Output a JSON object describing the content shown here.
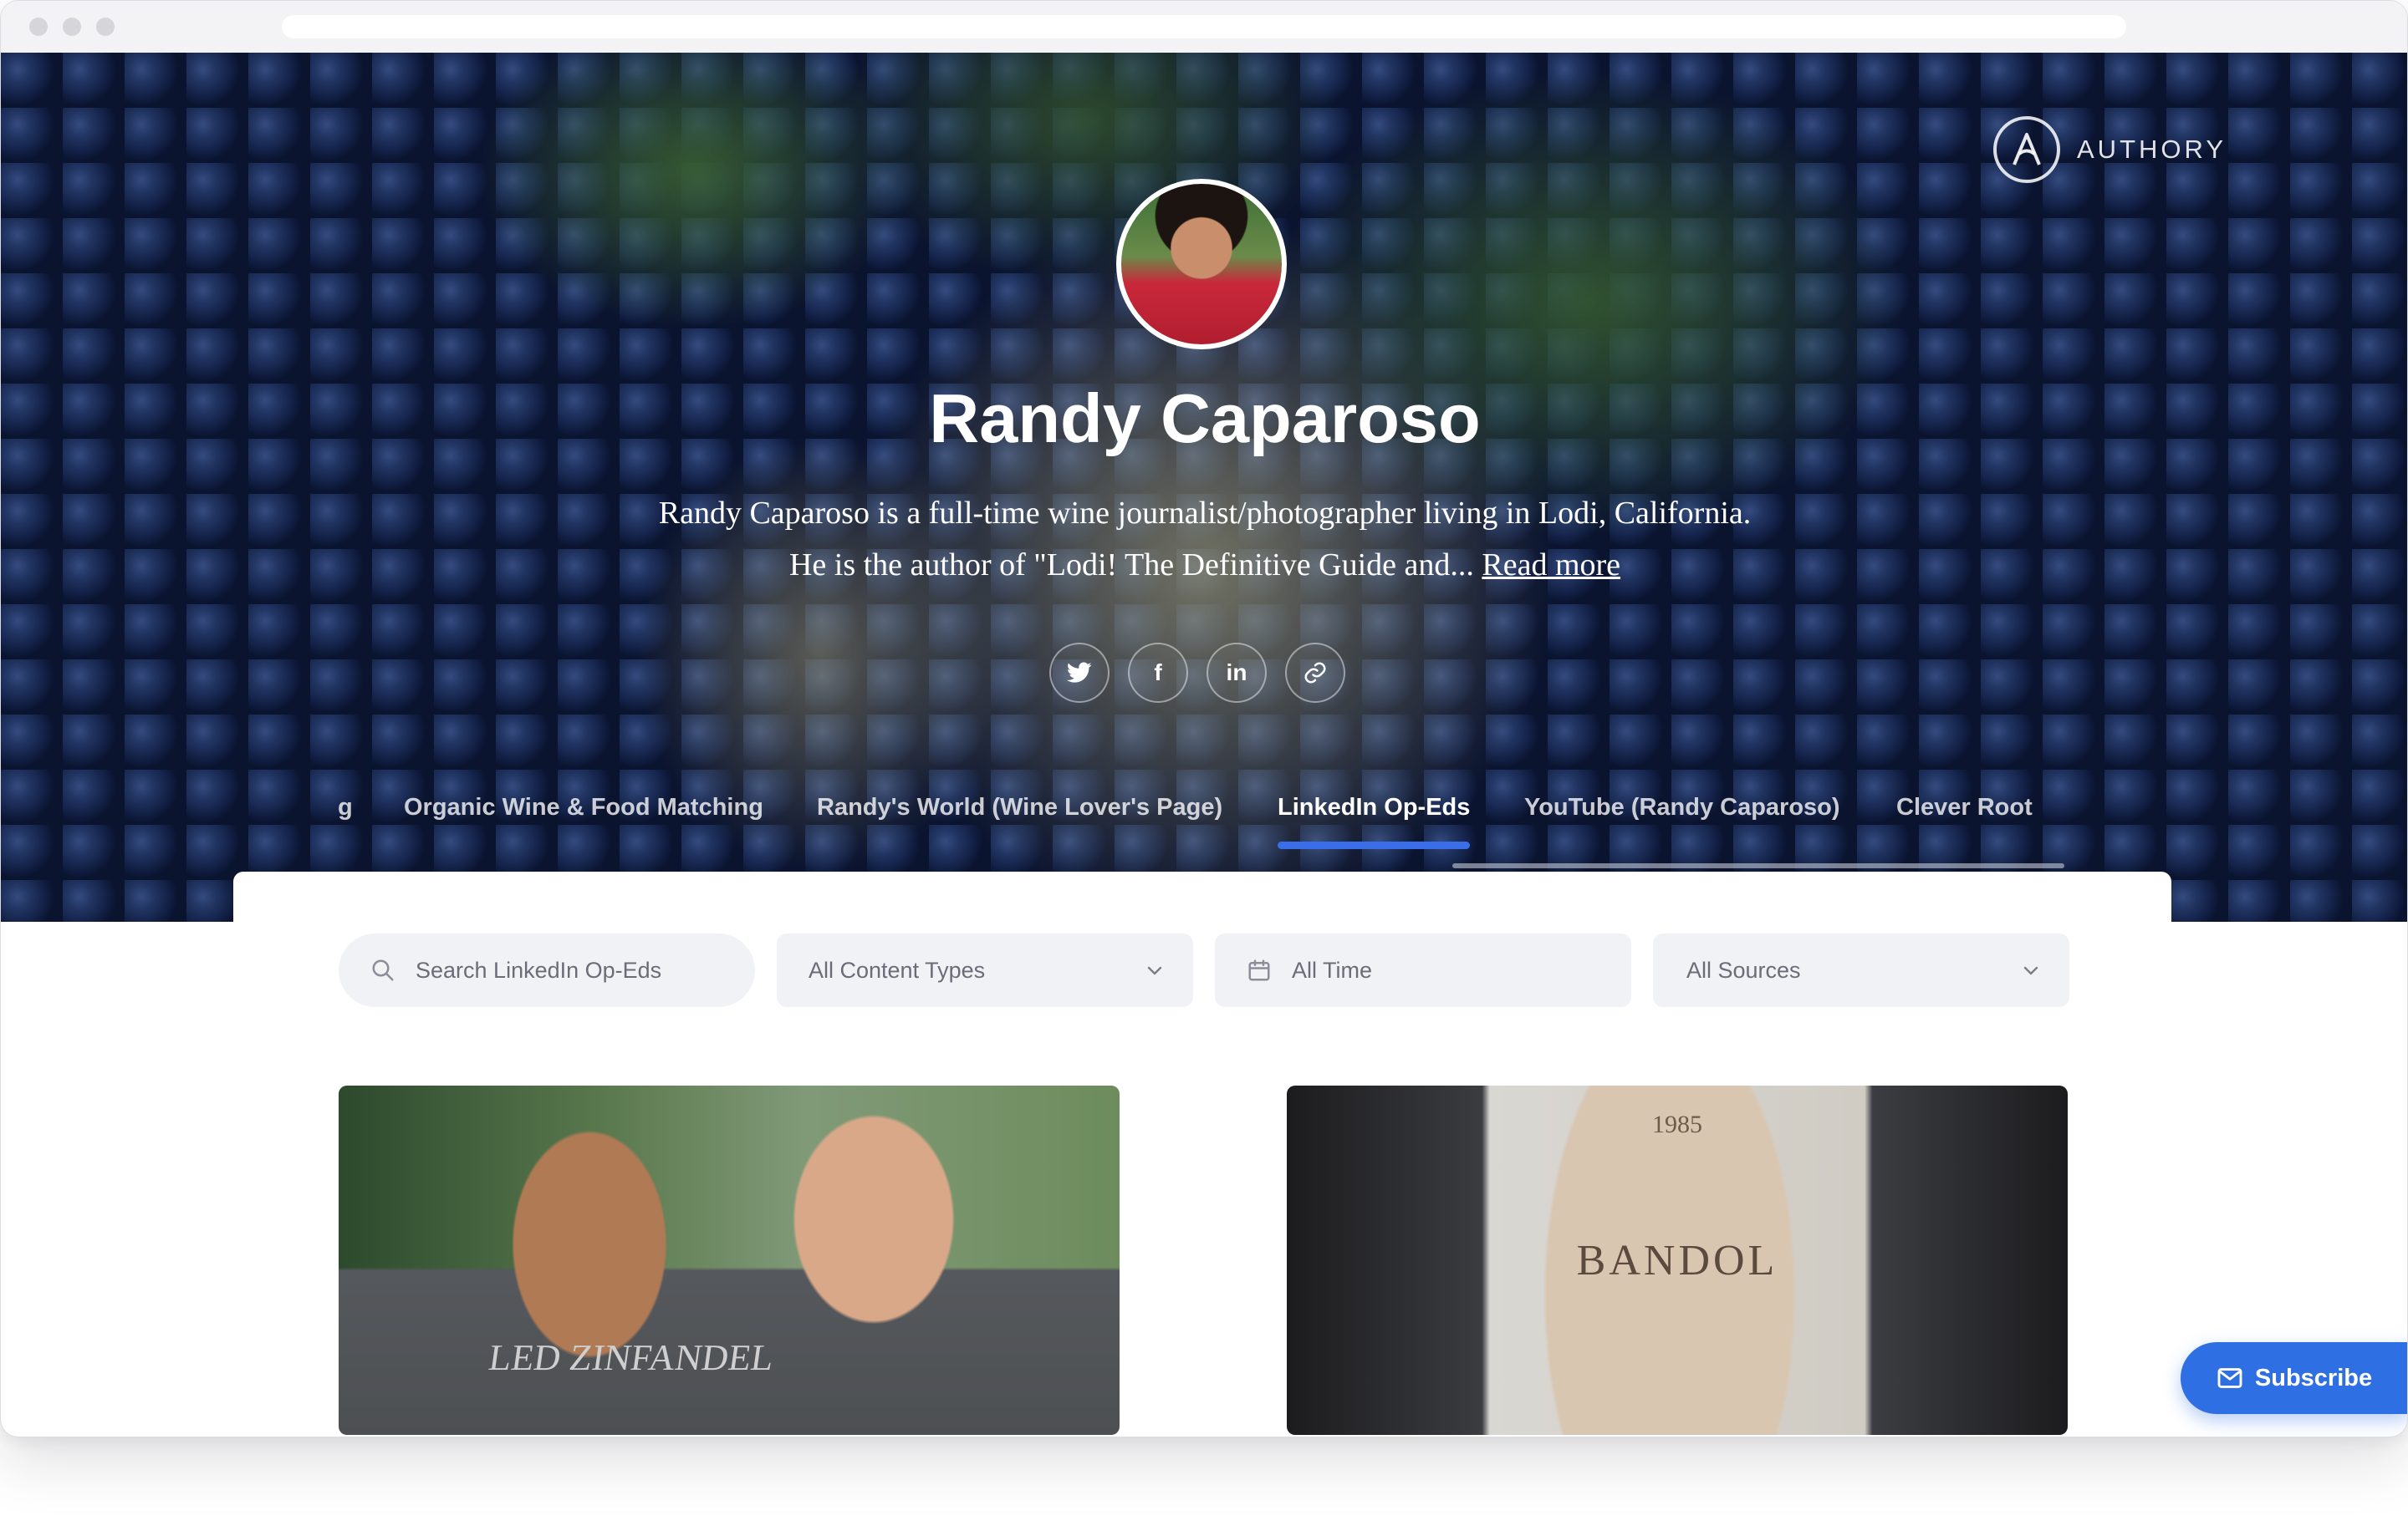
{
  "profile": {
    "name": "Randy Caparoso",
    "bio_line1": "Randy Caparoso is a full-time wine journalist/photographer living in Lodi, California.",
    "bio_line2": "He is the author of \"Lodi! The Definitive Guide and...",
    "read_more": "Read more"
  },
  "brand": {
    "name": "AUTHORY"
  },
  "socials": [
    {
      "icon": "twitter-icon"
    },
    {
      "icon": "facebook-icon",
      "glyph": "f"
    },
    {
      "icon": "linkedin-icon",
      "glyph": "in"
    },
    {
      "icon": "link-icon"
    }
  ],
  "tabs": [
    {
      "label": "g",
      "active": false
    },
    {
      "label": "Organic Wine & Food Matching",
      "active": false
    },
    {
      "label": "Randy's World (Wine Lover's Page)",
      "active": false
    },
    {
      "label": "LinkedIn Op-Eds",
      "active": true
    },
    {
      "label": "YouTube (Randy Caparoso)",
      "active": false
    },
    {
      "label": "Clever Root",
      "active": false
    }
  ],
  "filters": {
    "search_placeholder": "Search LinkedIn Op-Eds",
    "content_types": "All Content Types",
    "time": "All Time",
    "sources": "All Sources"
  },
  "articles": [
    {
      "image_text": "LED ZINFANDEL"
    },
    {
      "image_text_year": "1985",
      "image_text_label": "BANDOL"
    }
  ],
  "subscribe": {
    "label": "Subscribe"
  },
  "colors": {
    "accent": "#2f6fe4",
    "tab_underline": "#3a6ee8",
    "filter_bg": "#f1f2f5"
  }
}
